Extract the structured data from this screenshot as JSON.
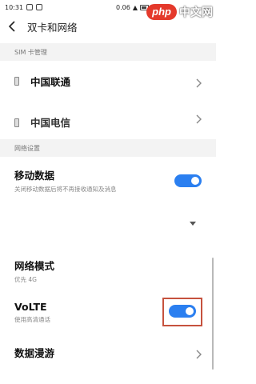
{
  "status_bar": {
    "time": "10:31",
    "net_speed": "0.06",
    "battery": ""
  },
  "watermark": {
    "brand": "php",
    "text": "中文网"
  },
  "header": {
    "title": "双卡和网络",
    "back_icon": "back-arrow-icon"
  },
  "sections": {
    "sim": {
      "title": "SIM 卡管理"
    },
    "network": {
      "title": "网络设置"
    }
  },
  "sim_cards": [
    {
      "label": "中国联通"
    },
    {
      "label": "中国电信"
    }
  ],
  "mobile_data": {
    "label": "移动数据",
    "sub": "关闭移动数据后将不再接收通知及消息",
    "enabled": true
  },
  "network_mode": {
    "label": "网络模式",
    "sub": "优先 4G"
  },
  "volte": {
    "label": "VoLTE",
    "sub": "使用高清通话",
    "enabled": true
  },
  "roaming": {
    "label": "数据漫游"
  },
  "colors": {
    "accent": "#2b7ff0",
    "highlight": "#c6523e",
    "section_bg": "#f3f3f3"
  }
}
